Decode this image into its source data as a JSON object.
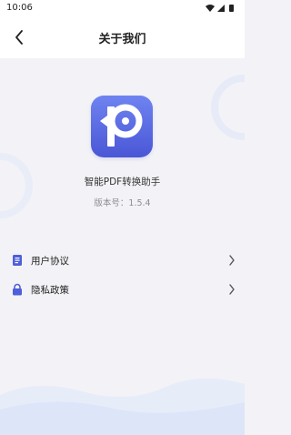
{
  "status_bar": {
    "time": "10:06"
  },
  "nav": {
    "title": "关于我们"
  },
  "app": {
    "name": "智能PDF转换助手",
    "version": "版本号：1.5.4"
  },
  "menu": [
    {
      "label": "用户协议",
      "icon": "document-icon"
    },
    {
      "label": "隐私政策",
      "icon": "lock-icon"
    }
  ],
  "colors": {
    "accent": "#5a6be6",
    "background": "#f3f3f7"
  }
}
